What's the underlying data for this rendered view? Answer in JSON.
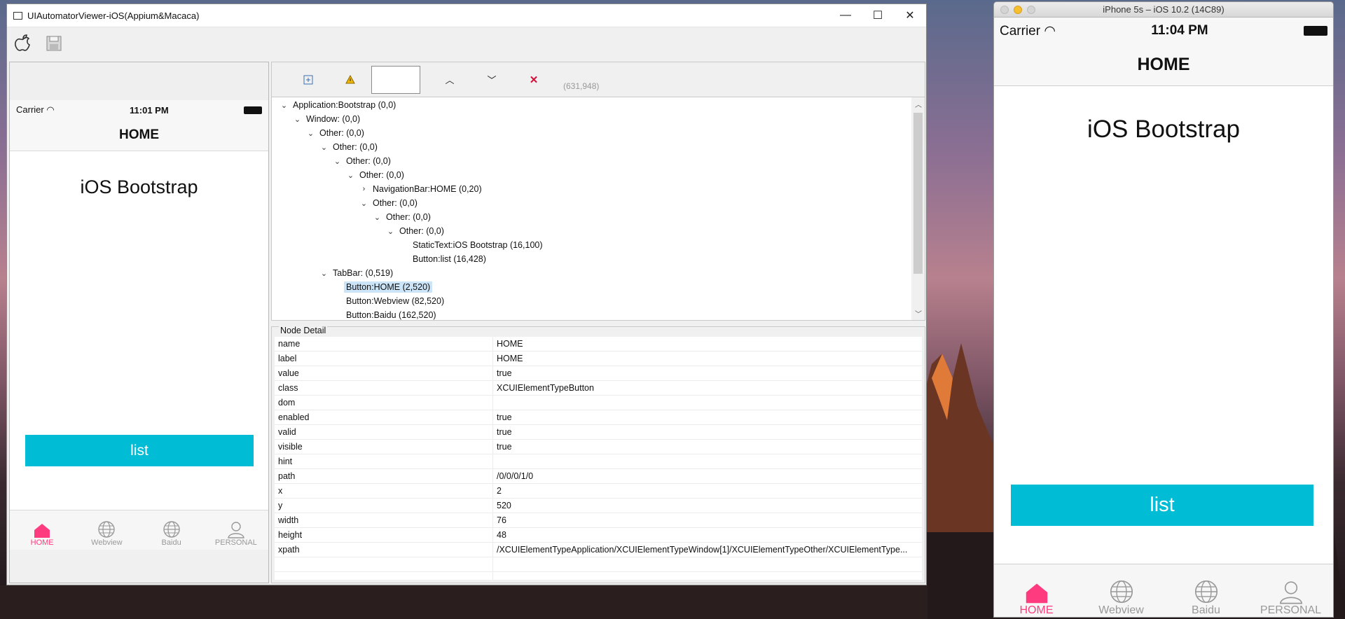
{
  "app": {
    "title": "UIAutomatorViewer-iOS(Appium&Macaca)",
    "window_controls": {
      "minimize": "—",
      "maximize": "☐",
      "close": "✕"
    },
    "toolbar": {
      "device_icon": "apple-icon",
      "save_icon": "save-icon"
    }
  },
  "device_preview": {
    "carrier": "Carrier",
    "time": "11:01 PM",
    "nav_title": "HOME",
    "heading": "iOS Bootstrap",
    "list_button": "list",
    "tabs": [
      {
        "label": "HOME",
        "icon": "home-icon",
        "active": true
      },
      {
        "label": "Webview",
        "icon": "globe-icon",
        "active": false
      },
      {
        "label": "Baidu",
        "icon": "globe-icon",
        "active": false
      },
      {
        "label": "PERSONAL",
        "icon": "person-icon",
        "active": false
      }
    ]
  },
  "inspector_toolbar": {
    "expand_icon": "expand-icon",
    "warning_icon": "warning-icon",
    "search_value": "",
    "up_icon": "chevron-up-icon",
    "down_icon": "chevron-down-icon",
    "clear_icon": "close-icon",
    "coordinates": "(631,948)"
  },
  "tree": [
    {
      "label": "Application:Bootstrap (0,0)",
      "depth": 0,
      "caret": "open"
    },
    {
      "label": "Window: (0,0)",
      "depth": 1,
      "caret": "open"
    },
    {
      "label": "Other: (0,0)",
      "depth": 2,
      "caret": "open"
    },
    {
      "label": "Other: (0,0)",
      "depth": 3,
      "caret": "open"
    },
    {
      "label": "Other: (0,0)",
      "depth": 4,
      "caret": "open"
    },
    {
      "label": "Other: (0,0)",
      "depth": 5,
      "caret": "open"
    },
    {
      "label": "NavigationBar:HOME (0,20)",
      "depth": 6,
      "caret": "closed"
    },
    {
      "label": "Other: (0,0)",
      "depth": 6,
      "caret": "open"
    },
    {
      "label": "Other: (0,0)",
      "depth": 7,
      "caret": "open"
    },
    {
      "label": "Other: (0,0)",
      "depth": 8,
      "caret": "open"
    },
    {
      "label": "StaticText:iOS Bootstrap (16,100)",
      "depth": 9,
      "caret": "none"
    },
    {
      "label": "Button:list (16,428)",
      "depth": 9,
      "caret": "none"
    },
    {
      "label": "TabBar: (0,519)",
      "depth": 3,
      "caret": "open"
    },
    {
      "label": "Button:HOME (2,520)",
      "depth": 4,
      "caret": "none",
      "selected": true
    },
    {
      "label": "Button:Webview (82,520)",
      "depth": 4,
      "caret": "none"
    },
    {
      "label": "Button:Baidu (162,520)",
      "depth": 4,
      "caret": "none"
    }
  ],
  "node_detail": {
    "title": "Node Detail",
    "rows": [
      {
        "key": "name",
        "value": "HOME"
      },
      {
        "key": "label",
        "value": "HOME"
      },
      {
        "key": "value",
        "value": "true"
      },
      {
        "key": "class",
        "value": "XCUIElementTypeButton"
      },
      {
        "key": "dom",
        "value": ""
      },
      {
        "key": "enabled",
        "value": "true"
      },
      {
        "key": "valid",
        "value": "true"
      },
      {
        "key": "visible",
        "value": "true"
      },
      {
        "key": "hint",
        "value": ""
      },
      {
        "key": "path",
        "value": "/0/0/0/1/0"
      },
      {
        "key": "x",
        "value": "2"
      },
      {
        "key": "y",
        "value": "520"
      },
      {
        "key": "width",
        "value": "76"
      },
      {
        "key": "height",
        "value": "48"
      },
      {
        "key": "xpath",
        "value": "/XCUIElementTypeApplication/XCUIElementTypeWindow[1]/XCUIElementTypeOther/XCUIElementType..."
      }
    ]
  },
  "simulator": {
    "window_title": "iPhone 5s – iOS 10.2 (14C89)",
    "carrier": "Carrier",
    "time": "11:04 PM",
    "nav_title": "HOME",
    "heading": "iOS Bootstrap",
    "list_button": "list",
    "tabs": [
      {
        "label": "HOME",
        "icon": "home-icon",
        "active": true
      },
      {
        "label": "Webview",
        "icon": "globe-icon",
        "active": false
      },
      {
        "label": "Baidu",
        "icon": "globe-icon",
        "active": false
      },
      {
        "label": "PERSONAL",
        "icon": "person-icon",
        "active": false
      }
    ]
  },
  "colors": {
    "accent": "#00bcd4",
    "tab_active": "#ff3b7f",
    "selection": "#cce4f7"
  }
}
